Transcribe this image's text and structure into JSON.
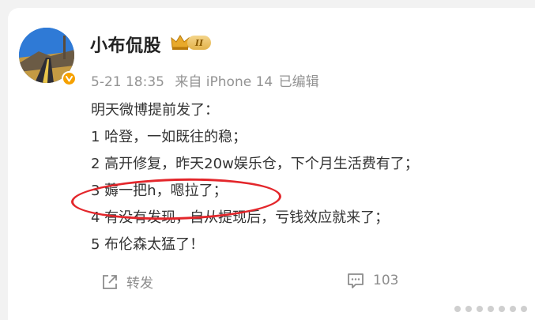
{
  "post": {
    "author": "小布侃股",
    "level_badge": "II",
    "date": "5-21 18:35",
    "source": "来自 iPhone 14",
    "edited": "已编辑",
    "lines": [
      "明天微博提前发了：",
      "1 哈登，一如既往的稳；",
      "2 高开修复，昨天20w娱乐仓，下个月生活费有了；",
      "3 薅一把h，嗯拉了；",
      "4 有没有发现，自从提现后，亏钱效应就来了；",
      "5 布伦森太猛了！"
    ],
    "highlighted_line_index": 3
  },
  "actions": {
    "repost_label": "转发",
    "comment_count": "103"
  },
  "icons": {
    "verified": "verified-badge-icon",
    "crown": "crown-icon",
    "repost": "repost-icon",
    "comment": "comment-icon"
  },
  "colors": {
    "verified": "#f6a100",
    "highlight_ellipse": "#e3262b",
    "meta_text": "#939393"
  }
}
